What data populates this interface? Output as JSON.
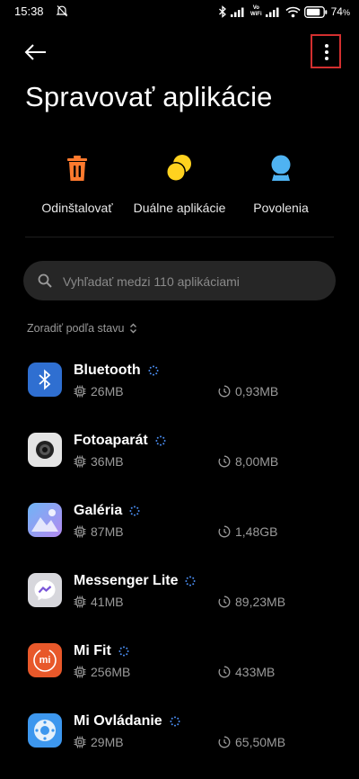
{
  "status_bar": {
    "time": "15:38",
    "battery_text": "74",
    "battery_unit": "%",
    "vowifi_top": "Vo",
    "vowifi_bottom": "WiFi"
  },
  "header": {
    "title": "Spravovať aplikácie"
  },
  "quick_actions": [
    {
      "label": "Odinštalovať",
      "icon": "trash-icon",
      "color": "#ff7a2e"
    },
    {
      "label": "Duálne aplikácie",
      "icon": "dual-apps-icon",
      "color": "#ffd21f"
    },
    {
      "label": "Povolenia",
      "icon": "permissions-icon",
      "color": "#4fb3f2"
    }
  ],
  "search": {
    "placeholder": "Vyhľadať medzi 110 aplikáciami"
  },
  "sort": {
    "label": "Zoradiť podľa stavu"
  },
  "apps": [
    {
      "name": "Bluetooth",
      "app_size": "26MB",
      "data_size": "0,93MB",
      "icon": "bluetooth-app-icon"
    },
    {
      "name": "Fotoaparát",
      "app_size": "36MB",
      "data_size": "8,00MB",
      "icon": "camera-app-icon"
    },
    {
      "name": "Galéria",
      "app_size": "87MB",
      "data_size": "1,48GB",
      "icon": "gallery-app-icon"
    },
    {
      "name": "Messenger Lite",
      "app_size": "41MB",
      "data_size": "89,23MB",
      "icon": "messenger-lite-app-icon"
    },
    {
      "name": "Mi Fit",
      "app_size": "256MB",
      "data_size": "433MB",
      "icon": "mi-fit-app-icon",
      "icon_text": "mi"
    },
    {
      "name": "Mi Ovládanie",
      "app_size": "29MB",
      "data_size": "65,50MB",
      "icon": "mi-remote-app-icon"
    }
  ],
  "colors": {
    "background": "#000000",
    "search_bg": "#262626",
    "secondary_text": "#9a9a9a",
    "highlight_box": "#d32f2f"
  }
}
